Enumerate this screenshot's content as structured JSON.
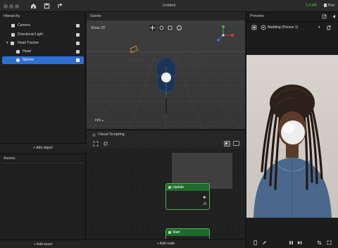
{
  "titlebar": {
    "title": "Untitled",
    "memory": "5.9 MB",
    "preview_label": "Prev"
  },
  "hierarchy": {
    "title": "Hierarchy",
    "items": [
      {
        "label": "Camera",
        "icon": "camera-icon"
      },
      {
        "label": "Directional Light",
        "icon": "light-icon"
      },
      {
        "label": "Head Tracker",
        "icon": "tracker-icon"
      },
      {
        "label": "Head",
        "icon": "head-icon"
      },
      {
        "label": "Sphere",
        "icon": "sphere-icon"
      }
    ],
    "add_label": "+ Add object"
  },
  "assets": {
    "title": "Assets",
    "add_label": "+ Add asset"
  },
  "scene": {
    "title": "Scene",
    "show2d": "Show 2D",
    "info": "Info"
  },
  "visual_scripting": {
    "title": "Visual Scripting",
    "nodes": [
      {
        "label": "Update"
      },
      {
        "label": "Start"
      }
    ],
    "add_label": "+ Add node"
  },
  "preview": {
    "title": "Preview",
    "selected": "Nodding (Person 1)"
  },
  "colors": {
    "accent": "#2d6fd4",
    "node_green": "#1f6b2c",
    "memory_green": "#3fbf3f"
  }
}
